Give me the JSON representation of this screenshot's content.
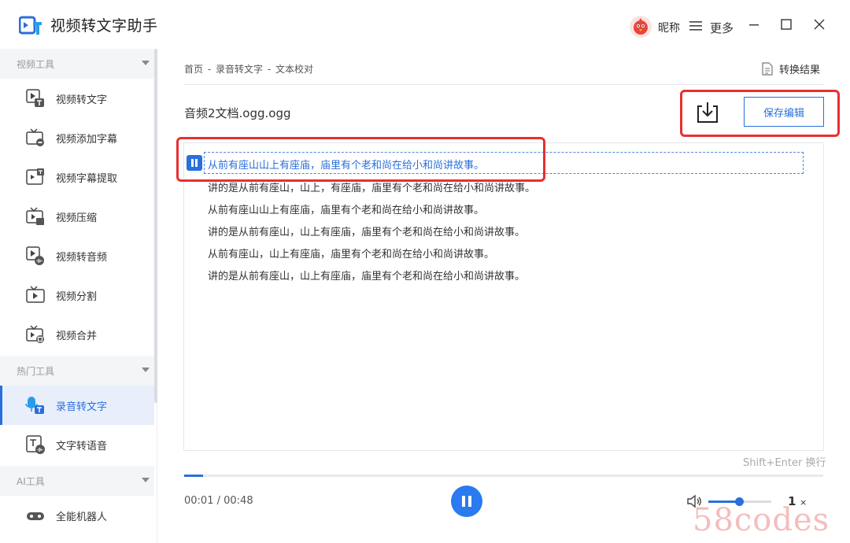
{
  "app": {
    "title": "视频转文字助手",
    "nickname": "昵称",
    "more_label": "更多",
    "accent_color": "#2a6fdb",
    "highlight_color": "#e8302f"
  },
  "sidebar": {
    "sections": [
      {
        "label": "视频工具",
        "items": [
          {
            "label": "视频转文字",
            "icon": "video-to-text-icon"
          },
          {
            "label": "视频添加字幕",
            "icon": "add-subtitle-icon"
          },
          {
            "label": "视频字幕提取",
            "icon": "extract-subtitle-icon"
          },
          {
            "label": "视频压缩",
            "icon": "video-compress-icon"
          },
          {
            "label": "视频转音频",
            "icon": "video-to-audio-icon"
          },
          {
            "label": "视频分割",
            "icon": "video-split-icon"
          },
          {
            "label": "视频合并",
            "icon": "video-merge-icon"
          }
        ]
      },
      {
        "label": "热门工具",
        "items": [
          {
            "label": "录音转文字",
            "icon": "recording-to-text-icon",
            "active": true
          },
          {
            "label": "文字转语音",
            "icon": "text-to-speech-icon"
          }
        ]
      },
      {
        "label": "AI工具",
        "items": [
          {
            "label": "全能机器人",
            "icon": "robot-icon"
          }
        ]
      }
    ]
  },
  "breadcrumb": [
    "首页",
    "录音转文字",
    "文本校对"
  ],
  "breadcrumb_sep": "-",
  "result_label": "转换结果",
  "document": {
    "title": "音频2文档.ogg.ogg",
    "save_label": "保存编辑",
    "active_line": "从前有座山山上有座庙，庙里有个老和尚在给小和尚讲故事。",
    "lines": [
      "讲的是从前有座山，山上，有座庙，庙里有个老和尚在给小和尚讲故事。",
      "从前有座山山上有座庙，庙里有个老和尚在给小和尚讲故事。",
      "讲的是从前有座山，山上有座庙，庙里有个老和尚在给小和尚讲故事。",
      "从前有座山，山上有座庙，庙里有个老和尚在给小和尚讲故事。",
      "讲的是从前有座山，山上有座庙，庙里有个老和尚在给小和尚讲故事。"
    ],
    "hint": "Shift+Enter 换行"
  },
  "player": {
    "current_time": "00:01",
    "total_time": "00:48",
    "time_sep": " / ",
    "progress": 0.03,
    "volume": 0.49,
    "speed": "1",
    "speed_unit": "×"
  },
  "watermark": "58codes"
}
